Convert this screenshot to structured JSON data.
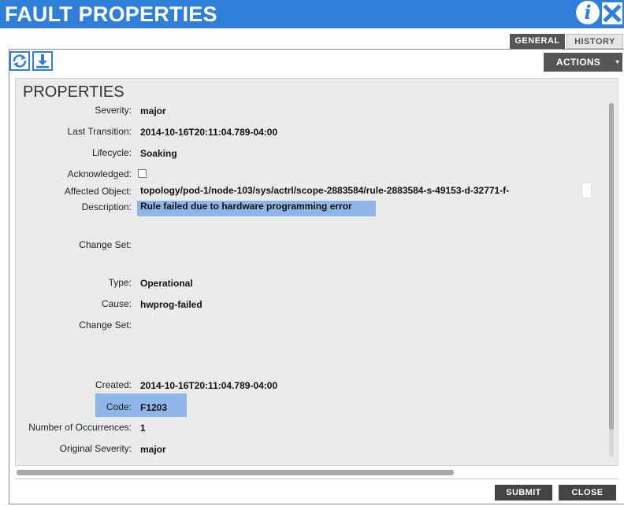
{
  "window": {
    "title": "FAULT PROPERTIES",
    "info_icon": "info-icon",
    "close_icon": "close-icon"
  },
  "tabs": [
    {
      "label": "GENERAL",
      "active": true
    },
    {
      "label": "HISTORY",
      "active": false
    }
  ],
  "toolbar": {
    "refresh_icon": "refresh-icon",
    "download_icon": "download-icon",
    "actions_label": "ACTIONS",
    "actions_caret": "▾"
  },
  "section": {
    "title": "PROPERTIES"
  },
  "fields": {
    "severity": {
      "label": "Severity:",
      "value": "major"
    },
    "last_transition": {
      "label": "Last Transition:",
      "value": "2014-10-16T20:11:04.789-04:00"
    },
    "lifecycle": {
      "label": "Lifecycle:",
      "value": "Soaking"
    },
    "acknowledged": {
      "label": "Acknowledged:",
      "checked": false
    },
    "affected_object": {
      "label": "Affected Object:",
      "value": "topology/pod-1/node-103/sys/actrl/scope-2883584/rule-2883584-s-49153-d-32771-f-"
    },
    "description": {
      "label": "Description:",
      "value": "Rule failed due to hardware programming error"
    },
    "change_set_1": {
      "label": "Change Set:",
      "value": ""
    },
    "type": {
      "label": "Type:",
      "value": "Operational"
    },
    "cause": {
      "label": "Cause:",
      "value": "hwprog-failed"
    },
    "change_set_2": {
      "label": "Change Set:",
      "value": ""
    },
    "created": {
      "label": "Created:",
      "value": "2014-10-16T20:11:04.789-04:00"
    },
    "code": {
      "label": "Code:",
      "value": "F1203"
    },
    "occurrences": {
      "label": "Number of Occurrences:",
      "value": "1"
    },
    "original_severity": {
      "label": "Original Severity:",
      "value": "major"
    }
  },
  "footer": {
    "submit_label": "SUBMIT",
    "close_label": "CLOSE"
  },
  "colors": {
    "title_bar": "#2f7ed8",
    "highlight": "#8fb6e8",
    "button_dark": "#444444",
    "panel_bg": "#ebebeb"
  }
}
